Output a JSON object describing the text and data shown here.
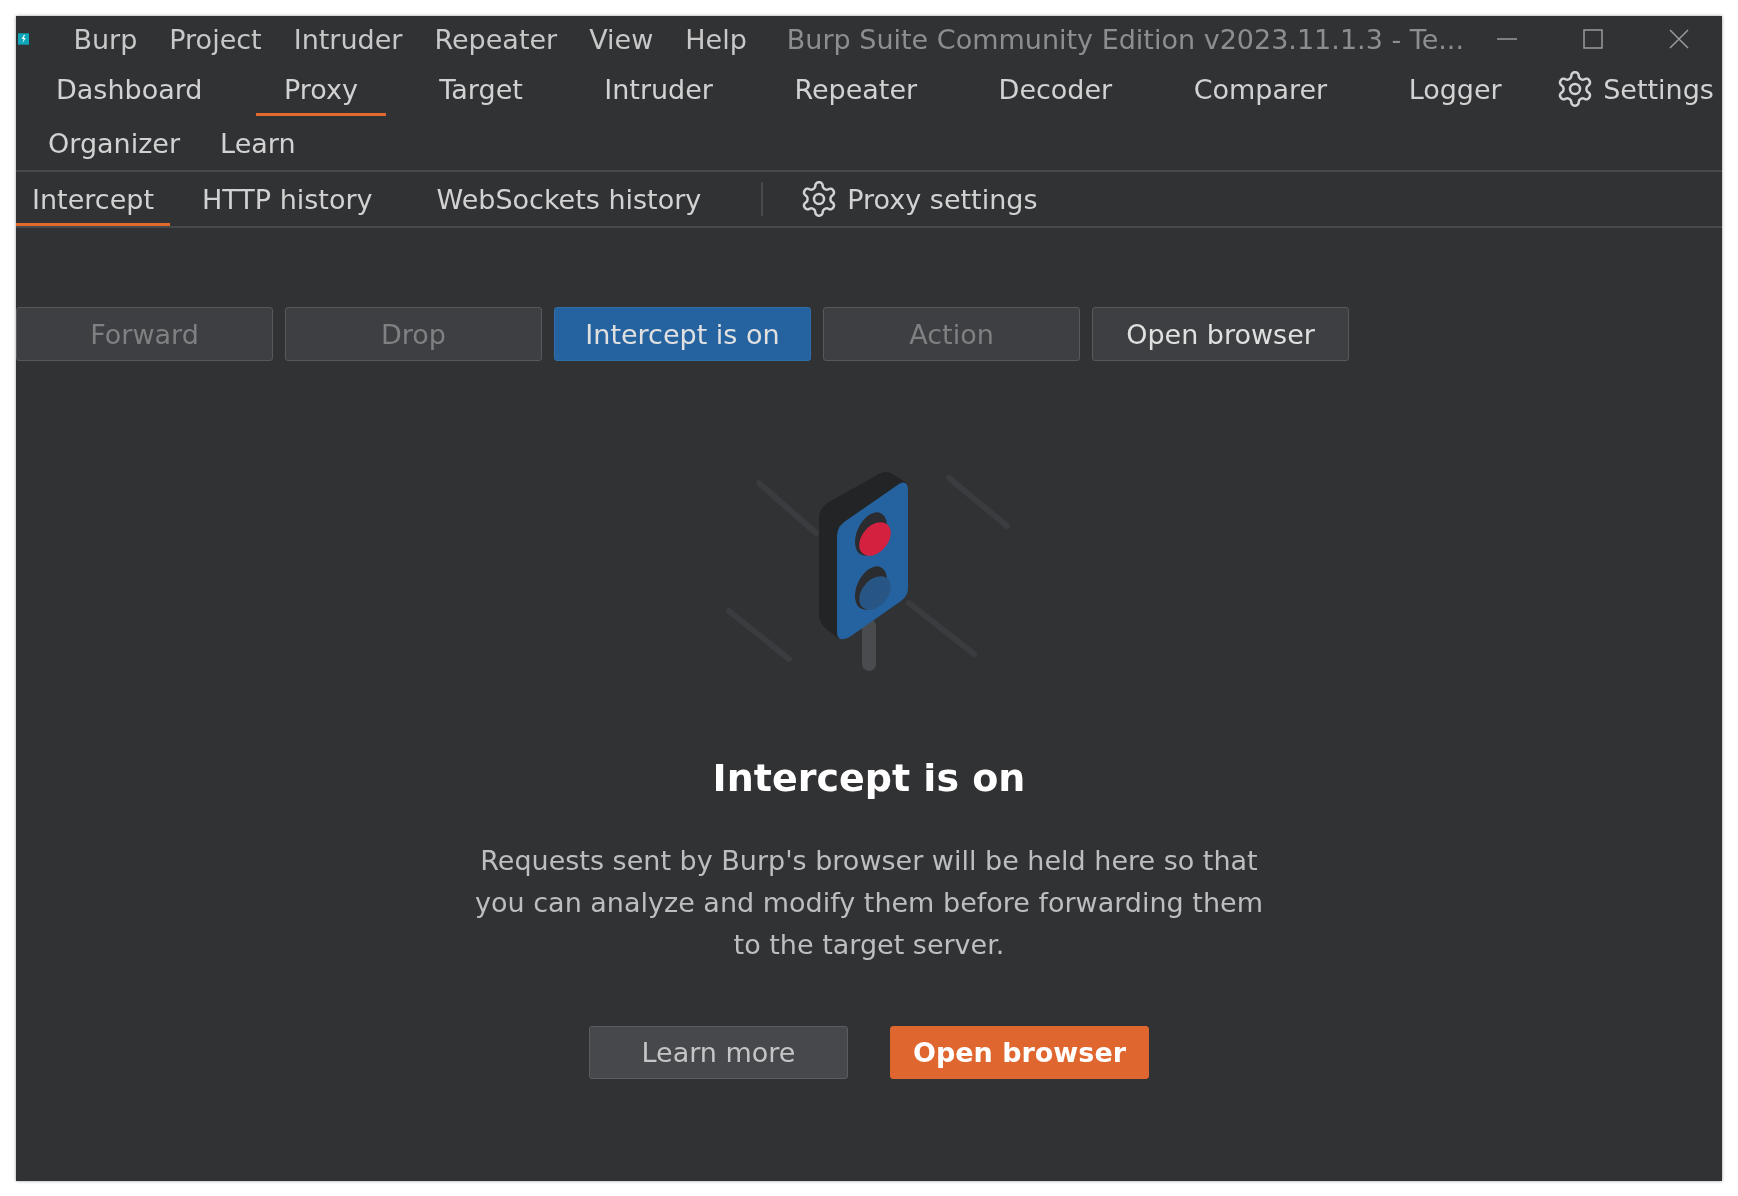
{
  "window": {
    "title": "Burp Suite Community Edition v2023.11.1.3 - Te..."
  },
  "menu": [
    "Burp",
    "Project",
    "Intruder",
    "Repeater",
    "View",
    "Help"
  ],
  "tabs": {
    "rows": [
      [
        {
          "label": "Dashboard",
          "selected": false
        },
        {
          "label": "Proxy",
          "selected": true
        },
        {
          "label": "Target",
          "selected": false
        },
        {
          "label": "Intruder",
          "selected": false
        },
        {
          "label": "Repeater",
          "selected": false
        },
        {
          "label": "Decoder",
          "selected": false
        },
        {
          "label": "Comparer",
          "selected": false
        },
        {
          "label": "Logger",
          "selected": false
        }
      ],
      [
        {
          "label": "Organizer",
          "selected": false
        },
        {
          "label": "Learn",
          "selected": false
        }
      ]
    ],
    "settings": "Settings"
  },
  "subtabs": {
    "items": [
      {
        "label": "Intercept",
        "selected": true
      },
      {
        "label": "HTTP history",
        "selected": false
      },
      {
        "label": "WebSockets history",
        "selected": false
      }
    ],
    "settings": "Proxy settings"
  },
  "actions": [
    {
      "label": "Forward",
      "kind": "plain",
      "disabled": true
    },
    {
      "label": "Drop",
      "kind": "plain",
      "disabled": true
    },
    {
      "label": "Intercept is on",
      "kind": "toggle",
      "disabled": false,
      "on": true
    },
    {
      "label": "Action",
      "kind": "plain",
      "disabled": true
    },
    {
      "label": "Open browser",
      "kind": "plain",
      "disabled": false
    }
  ],
  "empty_state": {
    "heading": "Intercept is on",
    "text": "Requests sent by Burp's browser will be held here so that you can analyze and modify them before forwarding them to the target server.",
    "buttons": [
      {
        "label": "Learn more",
        "kind": "secondary"
      },
      {
        "label": "Open browser",
        "kind": "primary"
      }
    ]
  }
}
